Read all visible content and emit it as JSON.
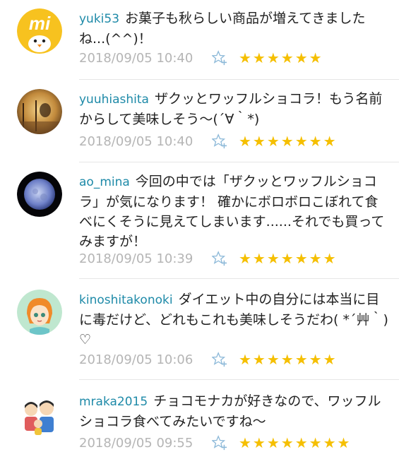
{
  "comments": [
    {
      "username": "yuki53",
      "text": "お菓子も秋らしい商品が増えてきましたね...(^^)！",
      "timestamp": "2018/09/05 10:40",
      "star_count": 6,
      "stars": "★★★★★★",
      "avatar_icon": "yellow-chick-logo-avatar",
      "avatar_logo_text": "mi"
    },
    {
      "username": "yuuhiashita",
      "text": "ザクッとワッフルショコラ！もう名前からして美味しそう〜(´∀｀*)",
      "timestamp": "2018/09/05 10:40",
      "star_count": 7,
      "stars": "★★★★★★★",
      "avatar_icon": "sunset-photo-avatar"
    },
    {
      "username": "ao_mina",
      "text": "今回の中では「ザクッとワッフルショコラ」が気になります！ 確かにボロボロこぼれて食べにくそうに見えてしまいます......それでも買ってみますが！",
      "timestamp": "2018/09/05 10:39",
      "star_count": 7,
      "stars": "★★★★★★★",
      "avatar_icon": "full-moon-avatar"
    },
    {
      "username": "kinoshitakonoki",
      "text": "ダイエット中の自分には本当に目に毒だけど、どれもこれも美味しそうだわ( *´艸｀)♡",
      "timestamp": "2018/09/05 10:06",
      "star_count": 7,
      "stars": "★★★★★★★",
      "avatar_icon": "illustrated-girl-avatar"
    },
    {
      "username": "mraka2015",
      "text": "チョコモナカが好きなので、ワッフルショコラ食べてみたいですね〜",
      "timestamp": "2018/09/05 09:55",
      "star_count": 8,
      "stars": "★★★★★★★★",
      "avatar_icon": "illustrated-family-avatar"
    }
  ],
  "colors": {
    "username": "#1e8aa8",
    "timestamp": "#b5b5b5",
    "star": "#f5bf00",
    "fav_icon": "#8bb8d8"
  },
  "icons": {
    "favorite": "star-plus-outline-icon"
  }
}
